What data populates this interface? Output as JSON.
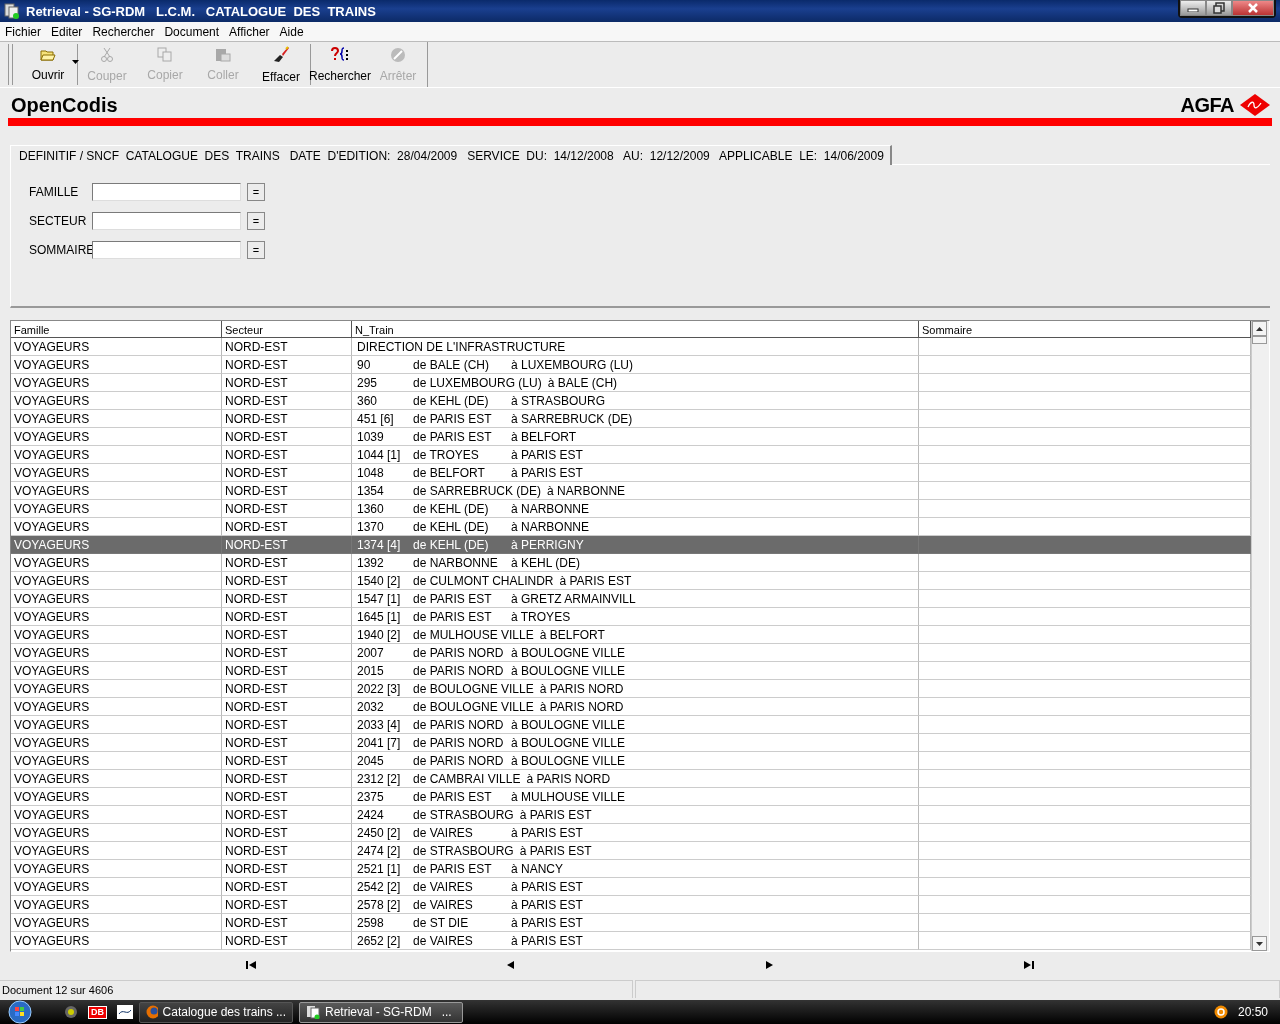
{
  "window": {
    "title": "Retrieval - SG-RDM   L.C.M.   CATALOGUE  DES  TRAINS"
  },
  "menu": [
    "Fichier",
    "Editer",
    "Rechercher",
    "Document",
    "Afficher",
    "Aide"
  ],
  "toolbar": [
    {
      "label": "Ouvrir",
      "kind": "folder",
      "disabled": false,
      "dropdown": true,
      "separator_after": true
    },
    {
      "label": "Couper",
      "kind": "scissors",
      "disabled": true,
      "dropdown": false,
      "separator_after": false
    },
    {
      "label": "Copier",
      "kind": "copy",
      "disabled": true,
      "dropdown": false,
      "separator_after": false
    },
    {
      "label": "Coller",
      "kind": "paste",
      "disabled": true,
      "dropdown": false,
      "separator_after": false
    },
    {
      "label": "Effacer",
      "kind": "brush",
      "disabled": false,
      "dropdown": false,
      "separator_after": true
    },
    {
      "label": "Rechercher",
      "kind": "query",
      "disabled": false,
      "dropdown": false,
      "separator_after": false
    },
    {
      "label": "Arrêter",
      "kind": "stop",
      "disabled": true,
      "dropdown": false,
      "separator_after": false
    }
  ],
  "banner": {
    "product": "OpenCodis",
    "logo": "AGFA"
  },
  "tab": {
    "label": "DEFINITIF / SNCF  CATALOGUE  DES  TRAINS   DATE  D'EDITION:  28/04/2009   SERVICE  DU:  14/12/2008   AU:  12/12/2009   APPLICABLE  LE:  14/06/2009",
    "selected": true
  },
  "form": [
    {
      "label": "FAMILLE",
      "button": "="
    },
    {
      "label": "SECTEUR",
      "button": "="
    },
    {
      "label": "SOMMAIRE",
      "button": "="
    }
  ],
  "table": {
    "columns": [
      "Famille",
      "Secteur",
      "N_Train",
      "Sommaire"
    ],
    "rows": [
      {
        "famille": "VOYAGEURS",
        "secteur": "NORD-EST",
        "train": [
          "DIRECTION DE L'INFRASTRUCTURE"
        ],
        "selected": false
      },
      {
        "famille": "VOYAGEURS",
        "secteur": "NORD-EST",
        "train": [
          "90",
          "de BALE (CH)",
          "à LUXEMBOURG (LU)"
        ],
        "selected": false
      },
      {
        "famille": "VOYAGEURS",
        "secteur": "NORD-EST",
        "train": [
          "295",
          "de LUXEMBOURG (LU)",
          "à BALE (CH)"
        ],
        "selected": false
      },
      {
        "famille": "VOYAGEURS",
        "secteur": "NORD-EST",
        "train": [
          "360",
          "de KEHL (DE)",
          "à STRASBOURG"
        ],
        "selected": false
      },
      {
        "famille": "VOYAGEURS",
        "secteur": "NORD-EST",
        "train": [
          "451 [6]",
          "de PARIS EST",
          "à SARREBRUCK (DE)"
        ],
        "selected": false
      },
      {
        "famille": "VOYAGEURS",
        "secteur": "NORD-EST",
        "train": [
          "1039",
          "de PARIS EST",
          "à BELFORT"
        ],
        "selected": false
      },
      {
        "famille": "VOYAGEURS",
        "secteur": "NORD-EST",
        "train": [
          "1044 [1]",
          "de TROYES",
          "à PARIS EST"
        ],
        "selected": false
      },
      {
        "famille": "VOYAGEURS",
        "secteur": "NORD-EST",
        "train": [
          "1048",
          "de BELFORT",
          "à PARIS EST"
        ],
        "selected": false
      },
      {
        "famille": "VOYAGEURS",
        "secteur": "NORD-EST",
        "train": [
          "1354",
          "de SARREBRUCK (DE)",
          "à NARBONNE"
        ],
        "selected": false
      },
      {
        "famille": "VOYAGEURS",
        "secteur": "NORD-EST",
        "train": [
          "1360",
          "de KEHL (DE)",
          "à NARBONNE"
        ],
        "selected": false
      },
      {
        "famille": "VOYAGEURS",
        "secteur": "NORD-EST",
        "train": [
          "1370",
          "de KEHL (DE)",
          "à NARBONNE"
        ],
        "selected": false
      },
      {
        "famille": "VOYAGEURS",
        "secteur": "NORD-EST",
        "train": [
          "1374 [4]",
          "de KEHL (DE)",
          "à PERRIGNY"
        ],
        "selected": true
      },
      {
        "famille": "VOYAGEURS",
        "secteur": "NORD-EST",
        "train": [
          "1392",
          "de NARBONNE",
          "à KEHL (DE)"
        ],
        "selected": false
      },
      {
        "famille": "VOYAGEURS",
        "secteur": "NORD-EST",
        "train": [
          "1540 [2]",
          "de CULMONT CHALINDR",
          "à PARIS EST"
        ],
        "selected": false
      },
      {
        "famille": "VOYAGEURS",
        "secteur": "NORD-EST",
        "train": [
          "1547 [1]",
          "de PARIS EST",
          "à GRETZ ARMAINVILL"
        ],
        "selected": false
      },
      {
        "famille": "VOYAGEURS",
        "secteur": "NORD-EST",
        "train": [
          "1645 [1]",
          "de PARIS EST",
          "à TROYES"
        ],
        "selected": false
      },
      {
        "famille": "VOYAGEURS",
        "secteur": "NORD-EST",
        "train": [
          "1940 [2]",
          "de MULHOUSE VILLE",
          "à BELFORT"
        ],
        "selected": false
      },
      {
        "famille": "VOYAGEURS",
        "secteur": "NORD-EST",
        "train": [
          "2007",
          "de PARIS NORD",
          "à BOULOGNE VILLE"
        ],
        "selected": false
      },
      {
        "famille": "VOYAGEURS",
        "secteur": "NORD-EST",
        "train": [
          "2015",
          "de PARIS NORD",
          "à BOULOGNE VILLE"
        ],
        "selected": false
      },
      {
        "famille": "VOYAGEURS",
        "secteur": "NORD-EST",
        "train": [
          "2022 [3]",
          "de BOULOGNE VILLE",
          "à PARIS NORD"
        ],
        "selected": false
      },
      {
        "famille": "VOYAGEURS",
        "secteur": "NORD-EST",
        "train": [
          "2032",
          "de BOULOGNE VILLE",
          "à PARIS NORD"
        ],
        "selected": false
      },
      {
        "famille": "VOYAGEURS",
        "secteur": "NORD-EST",
        "train": [
          "2033 [4]",
          "de PARIS NORD",
          "à BOULOGNE VILLE"
        ],
        "selected": false
      },
      {
        "famille": "VOYAGEURS",
        "secteur": "NORD-EST",
        "train": [
          "2041 [7]",
          "de PARIS NORD",
          "à BOULOGNE VILLE"
        ],
        "selected": false
      },
      {
        "famille": "VOYAGEURS",
        "secteur": "NORD-EST",
        "train": [
          "2045",
          "de PARIS NORD",
          "à BOULOGNE VILLE"
        ],
        "selected": false
      },
      {
        "famille": "VOYAGEURS",
        "secteur": "NORD-EST",
        "train": [
          "2312 [2]",
          "de CAMBRAI VILLE",
          "à PARIS NORD"
        ],
        "selected": false
      },
      {
        "famille": "VOYAGEURS",
        "secteur": "NORD-EST",
        "train": [
          "2375",
          "de PARIS EST",
          "à MULHOUSE VILLE"
        ],
        "selected": false
      },
      {
        "famille": "VOYAGEURS",
        "secteur": "NORD-EST",
        "train": [
          "2424",
          "de STRASBOURG",
          "à PARIS EST"
        ],
        "selected": false
      },
      {
        "famille": "VOYAGEURS",
        "secteur": "NORD-EST",
        "train": [
          "2450 [2]",
          "de VAIRES",
          "à PARIS EST"
        ],
        "selected": false
      },
      {
        "famille": "VOYAGEURS",
        "secteur": "NORD-EST",
        "train": [
          "2474 [2]",
          "de STRASBOURG",
          "à PARIS EST"
        ],
        "selected": false
      },
      {
        "famille": "VOYAGEURS",
        "secteur": "NORD-EST",
        "train": [
          "2521 [1]",
          "de PARIS EST",
          "à NANCY"
        ],
        "selected": false
      },
      {
        "famille": "VOYAGEURS",
        "secteur": "NORD-EST",
        "train": [
          "2542 [2]",
          "de VAIRES",
          "à PARIS EST"
        ],
        "selected": false
      },
      {
        "famille": "VOYAGEURS",
        "secteur": "NORD-EST",
        "train": [
          "2578 [2]",
          "de VAIRES",
          "à PARIS EST"
        ],
        "selected": false
      },
      {
        "famille": "VOYAGEURS",
        "secteur": "NORD-EST",
        "train": [
          "2598",
          "de ST DIE",
          "à PARIS EST"
        ],
        "selected": false
      },
      {
        "famille": "VOYAGEURS",
        "secteur": "NORD-EST",
        "train": [
          "2652 [2]",
          "de VAIRES",
          "à PARIS EST"
        ],
        "selected": false
      }
    ]
  },
  "status_bar": {
    "text": "Document 12 sur 4606"
  },
  "taskbar": {
    "quick_launch_label": "DB",
    "tasks": [
      {
        "label": "Catalogue des trains ...",
        "kind": "browser",
        "selected": false
      },
      {
        "label": "Retrieval - SG-RDM   ...",
        "kind": "app",
        "selected": true
      }
    ],
    "clock": "20:50"
  }
}
